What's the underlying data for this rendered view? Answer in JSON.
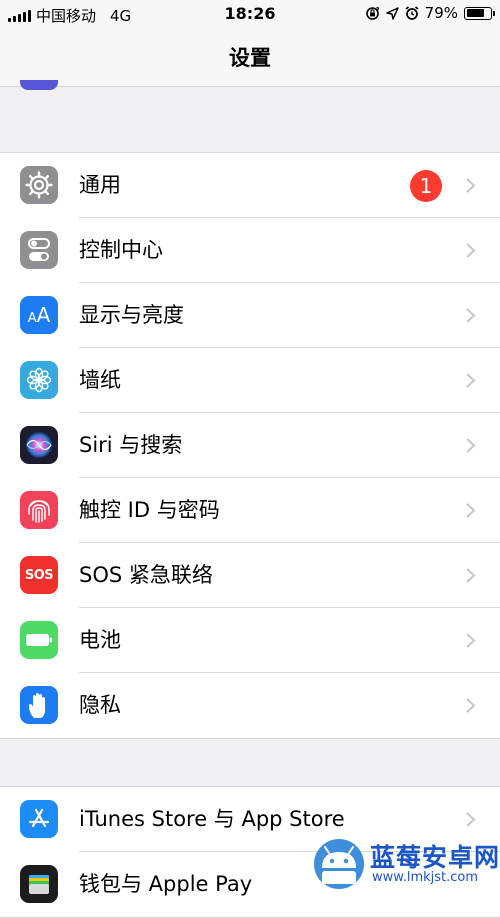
{
  "status_bar": {
    "carrier": "中国移动",
    "network": "4G",
    "time": "18:26",
    "battery_text": "79%",
    "battery_level": 0.79,
    "icons": [
      "orientation-lock-icon",
      "location-arrow-icon",
      "alarm-icon"
    ]
  },
  "nav": {
    "title": "设置"
  },
  "groups": [
    {
      "items": [
        {
          "label": "通用",
          "icon": "gear-icon",
          "color": "#8e8e93",
          "badge": "1"
        },
        {
          "label": "控制中心",
          "icon": "toggles-icon",
          "color": "#8e8e93"
        },
        {
          "label": "显示与亮度",
          "icon": "text-size-icon",
          "color": "#1e7cf2",
          "icon_text": "AA"
        },
        {
          "label": "墙纸",
          "icon": "flower-icon",
          "color": "#36aadc"
        },
        {
          "label": "Siri 与搜索",
          "icon": "siri-icon",
          "color": "#1c1c2e"
        },
        {
          "label": "触控 ID 与密码",
          "icon": "fingerprint-icon",
          "color": "#f2425a"
        },
        {
          "label": "SOS 紧急联络",
          "icon": "sos-icon",
          "color": "#f0302c",
          "icon_text": "SOS"
        },
        {
          "label": "电池",
          "icon": "battery-icon",
          "color": "#4cd964"
        },
        {
          "label": "隐私",
          "icon": "hand-icon",
          "color": "#1e7cf2"
        }
      ]
    },
    {
      "items": [
        {
          "label": "iTunes Store 与 App Store",
          "icon": "app-store-icon",
          "color": "#1d8df5"
        },
        {
          "label": "钱包与 Apple Pay",
          "icon": "wallet-icon",
          "color": "#1c1c1e"
        }
      ]
    }
  ],
  "watermark": {
    "brand": "蓝莓安卓网",
    "url": "www.lmkjst.com"
  }
}
